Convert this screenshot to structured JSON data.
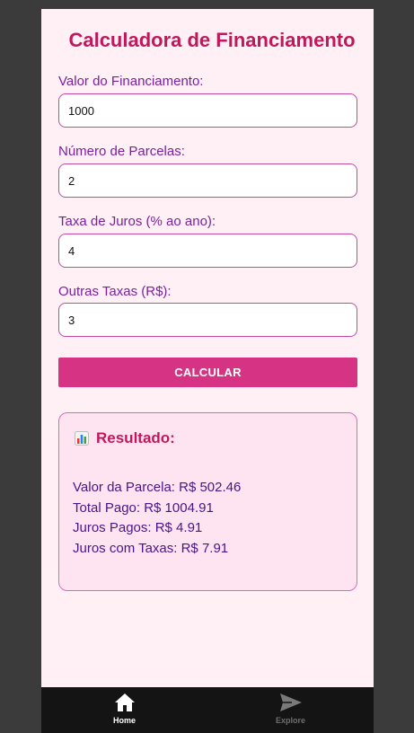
{
  "app": {
    "title": "Calculadora de Financiamento"
  },
  "fields": [
    {
      "label": "Valor do Financiamento:",
      "value": "1000"
    },
    {
      "label": "Número de Parcelas:",
      "value": "2"
    },
    {
      "label": "Taxa de Juros (% ao ano):",
      "value": "4"
    },
    {
      "label": "Outras Taxas (R$):",
      "value": "3"
    }
  ],
  "calculate_button": {
    "label": "CALCULAR"
  },
  "result": {
    "icon": "bar-chart-icon",
    "title": "Resultado:",
    "lines": [
      "Valor da Parcela: R$ 502.46",
      "Total Pago: R$ 1004.91",
      "Juros Pagos: R$ 4.91",
      "Juros com Taxas: R$ 7.91"
    ]
  },
  "tabbar": {
    "tabs": [
      {
        "label": "Home",
        "icon": "home-icon",
        "active": true
      },
      {
        "label": "Explore",
        "icon": "send-icon",
        "active": false
      }
    ]
  },
  "colors": {
    "background": "#fff0f5",
    "title": "#c2185b",
    "label": "#7b1fa2",
    "button": "#d63384",
    "result_bg": "#fde4f0",
    "tabbar": "#141414"
  }
}
